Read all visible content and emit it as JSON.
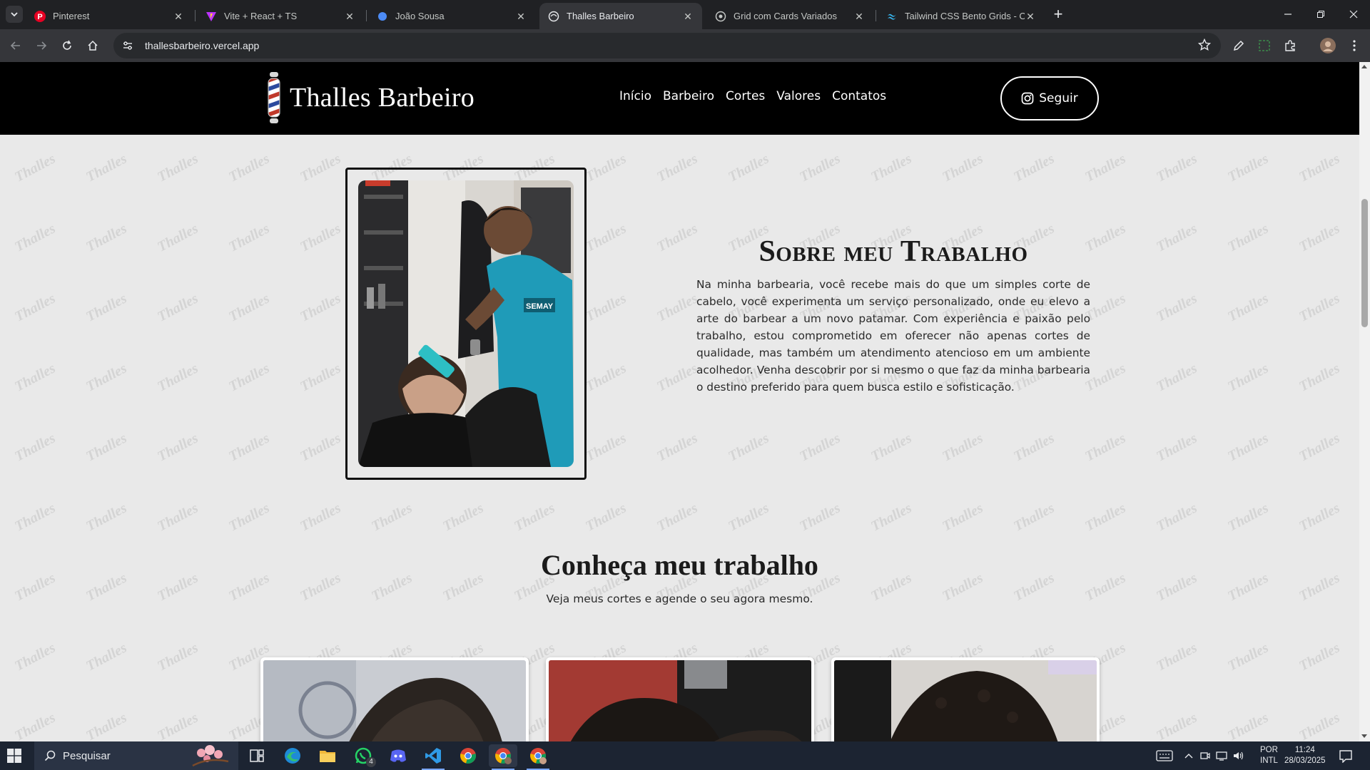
{
  "browser": {
    "tabs": [
      {
        "title": "Pinterest",
        "icon": "pinterest-icon",
        "color": "#e60023"
      },
      {
        "title": "Vite + React + TS",
        "icon": "vite-icon",
        "color": "#bd34fe"
      },
      {
        "title": "João Sousa",
        "icon": "globe-icon",
        "color": "#4c8bf5"
      },
      {
        "title": "Thalles Barbeiro",
        "icon": "site-icon",
        "color": "#e8eaed"
      },
      {
        "title": "Grid com Cards Variados",
        "icon": "globe-icon",
        "color": "#c4c7c5"
      },
      {
        "title": "Tailwind CSS Bento Grids - Offic",
        "icon": "tailwind-icon",
        "color": "#38bdf8"
      }
    ],
    "url": "thallesbarbeiro.vercel.app"
  },
  "site": {
    "brand": "Thalles Barbeiro",
    "nav": [
      "Início",
      "Barbeiro",
      "Cortes",
      "Valores",
      "Contatos"
    ],
    "follow_label": "Seguir",
    "about": {
      "title": "Sobre meu Trabalho",
      "text": "Na minha barbearia, você recebe mais do que um simples corte de cabelo, você experimenta um serviço personalizado, onde eu elevo a arte do barbear a um novo patamar. Com experiência e paixão pelo trabalho, estou comprometido em oferecer não apenas cortes de qualidade, mas também um atendimento atencioso em um ambiente acolhedor. Venha descobrir por si mesmo o que faz da minha barbearia o destino preferido para quem busca estilo e sofisticação."
    },
    "gallery": {
      "title": "Conheça meu trabalho",
      "subtitle": "Veja meus cortes e agende o seu agora mesmo."
    },
    "watermark": "Thalles"
  },
  "taskbar": {
    "search_placeholder": "Pesquisar",
    "whatsapp_badge": "4",
    "lang_top": "POR",
    "lang_bottom": "INTL",
    "time": "11:24",
    "date": "28/03/2025"
  }
}
